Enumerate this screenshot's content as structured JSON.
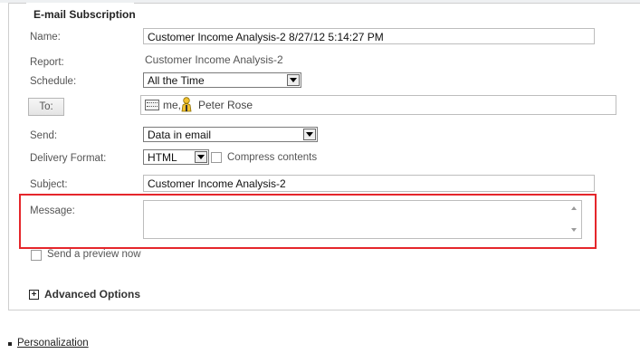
{
  "section": {
    "title": "E-mail Subscription"
  },
  "form": {
    "name_label": "Name:",
    "name_value": "Customer Income Analysis-2 8/27/12 5:14:27 PM",
    "report_label": "Report:",
    "report_value": "Customer Income Analysis-2",
    "schedule_label": "Schedule:",
    "schedule_value": "All the Time",
    "to_button": "To:",
    "recipient_me": "me,",
    "recipient_user": "Peter Rose",
    "send_label": "Send:",
    "send_value": "Data in email",
    "delivery_label": "Delivery Format:",
    "delivery_value": "HTML",
    "compress_label": "Compress contents",
    "subject_label": "Subject:",
    "subject_value": "Customer Income Analysis-2",
    "message_label": "Message:",
    "message_value": "",
    "preview_label": "Send a preview now",
    "advanced_label": "Advanced Options"
  },
  "footer": {
    "personalization_link": "Personalization"
  },
  "colors": {
    "highlight": "#e5262b"
  }
}
